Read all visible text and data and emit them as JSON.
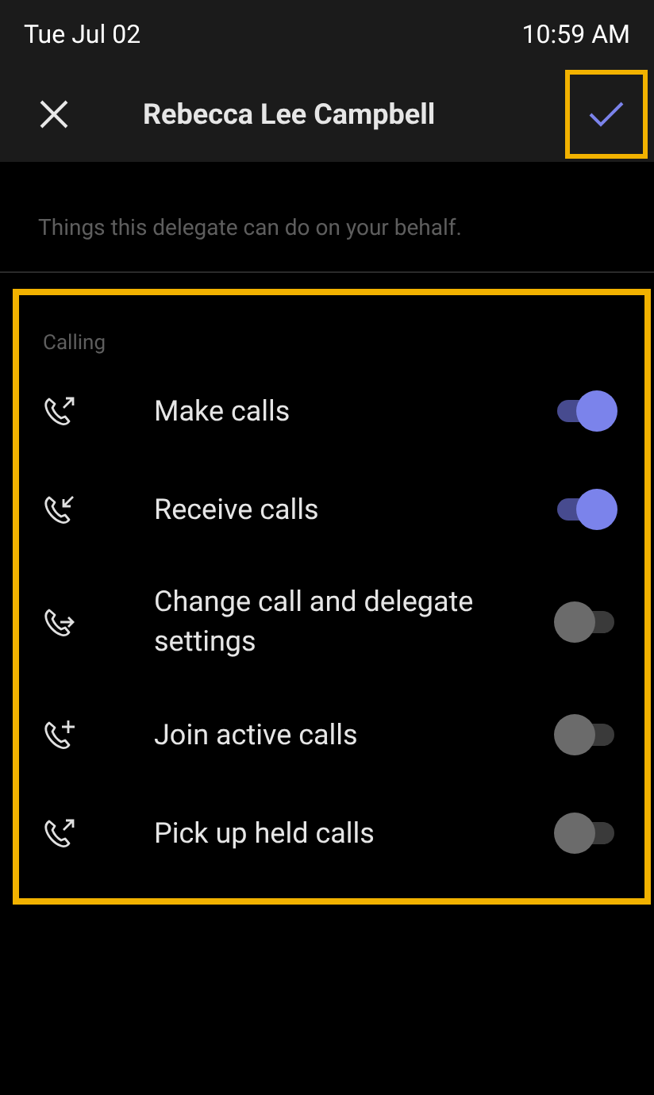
{
  "status_bar": {
    "date": "Tue Jul 02",
    "time": "10:59 AM"
  },
  "header": {
    "title": "Rebecca Lee Campbell",
    "confirm_highlighted": true
  },
  "description": "Things this delegate can do on your behalf.",
  "section": {
    "title": "Calling",
    "highlighted": true,
    "items": [
      {
        "kind": "outgoing",
        "label": "Make calls",
        "on": true
      },
      {
        "kind": "incoming",
        "label": "Receive calls",
        "on": true
      },
      {
        "kind": "forward",
        "label": "Change call and delegate settings",
        "on": false
      },
      {
        "kind": "add",
        "label": "Join active calls",
        "on": false
      },
      {
        "kind": "outgoing",
        "label": "Pick up held calls",
        "on": false
      }
    ]
  }
}
